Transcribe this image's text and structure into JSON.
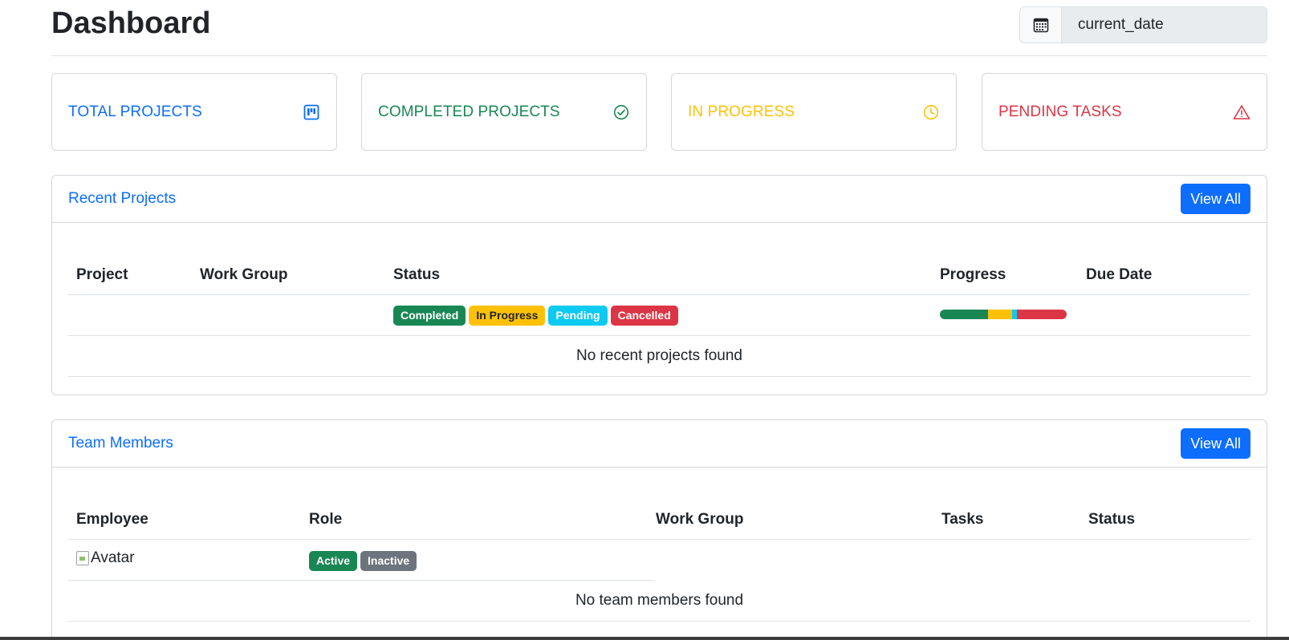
{
  "header": {
    "title": "Dashboard",
    "date_value": "current_date",
    "date_icon": "calendar-icon"
  },
  "stats": [
    {
      "label": "TOTAL PROJECTS",
      "icon": "kanban-icon",
      "color": "#0d6efd"
    },
    {
      "label": "COMPLETED PROJECTS",
      "icon": "check-circle-icon",
      "color": "#198754"
    },
    {
      "label": "IN PROGRESS",
      "icon": "clock-icon",
      "color": "#ffc107"
    },
    {
      "label": "PENDING TASKS",
      "icon": "warning-triangle-icon",
      "color": "#dc3545"
    }
  ],
  "recent_projects": {
    "title": "Recent Projects",
    "view_all_label": "View All",
    "columns": [
      "Project",
      "Work Group",
      "Status",
      "Progress",
      "Due Date"
    ],
    "status_badges": [
      {
        "label": "Completed",
        "color": "#198754"
      },
      {
        "label": "In Progress",
        "color": "#ffc107"
      },
      {
        "label": "Pending",
        "color": "#0dcaf0"
      },
      {
        "label": "Cancelled",
        "color": "#dc3545"
      }
    ],
    "progress_segments": [
      {
        "fraction": 0.38,
        "color": "#198754"
      },
      {
        "fraction": 0.19,
        "color": "#ffc107"
      },
      {
        "fraction": 0.04,
        "color": "#0dcaf0"
      },
      {
        "fraction": 0.39,
        "color": "#dc3545"
      }
    ],
    "empty_message": "No recent projects found"
  },
  "team_members": {
    "title": "Team Members",
    "view_all_label": "View All",
    "columns": [
      "Employee",
      "Role",
      "Work Group",
      "Tasks",
      "Status"
    ],
    "avatar_alt": "Avatar",
    "status_badges": [
      {
        "label": "Active",
        "color": "#198754"
      },
      {
        "label": "Inactive",
        "color": "#6c757d"
      }
    ],
    "empty_message": "No team members found"
  },
  "colors": {
    "primary": "#0d6efd",
    "border": "#dee2e6",
    "text": "#212529"
  }
}
